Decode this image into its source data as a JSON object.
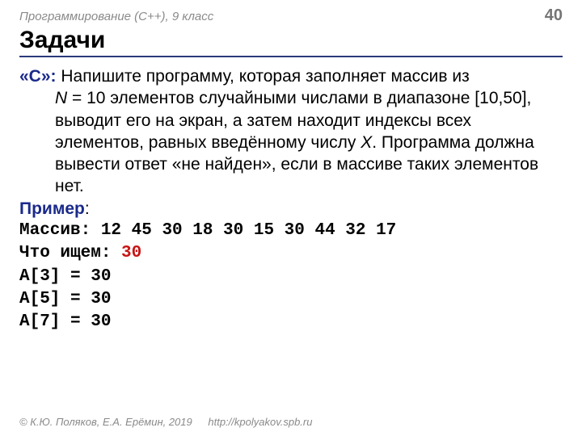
{
  "header": {
    "course": "Программирование (C++), 9 класс",
    "page": "40"
  },
  "title": "Задачи",
  "task": {
    "label": "«C»:",
    "line1": " Напишите программу, которая заполняет массив из ",
    "nvar": "N",
    "line2": " = 10 элементов случайными числами в диапазоне [10,50], выводит его на экран, а затем находит индексы всех элементов, равных введённому числу ",
    "xvar": "X",
    "line3": ". Программа должна вывести ответ «не найден», если в массиве таких элементов нет."
  },
  "example": {
    "label": "Пример",
    "colon": ":",
    "arr_label": "Массив: ",
    "arr_values": "12 45 30 18 30 15 30 44 32 17",
    "search_label": "Что ищем: ",
    "search_value": "30",
    "r1": "A[3] = 30",
    "r2": "A[5] = 30",
    "r3": "A[7] = 30"
  },
  "footer": {
    "copyright": "© К.Ю. Поляков, Е.А. Ерёмин, 2019",
    "url": "http://kpolyakov.spb.ru"
  }
}
